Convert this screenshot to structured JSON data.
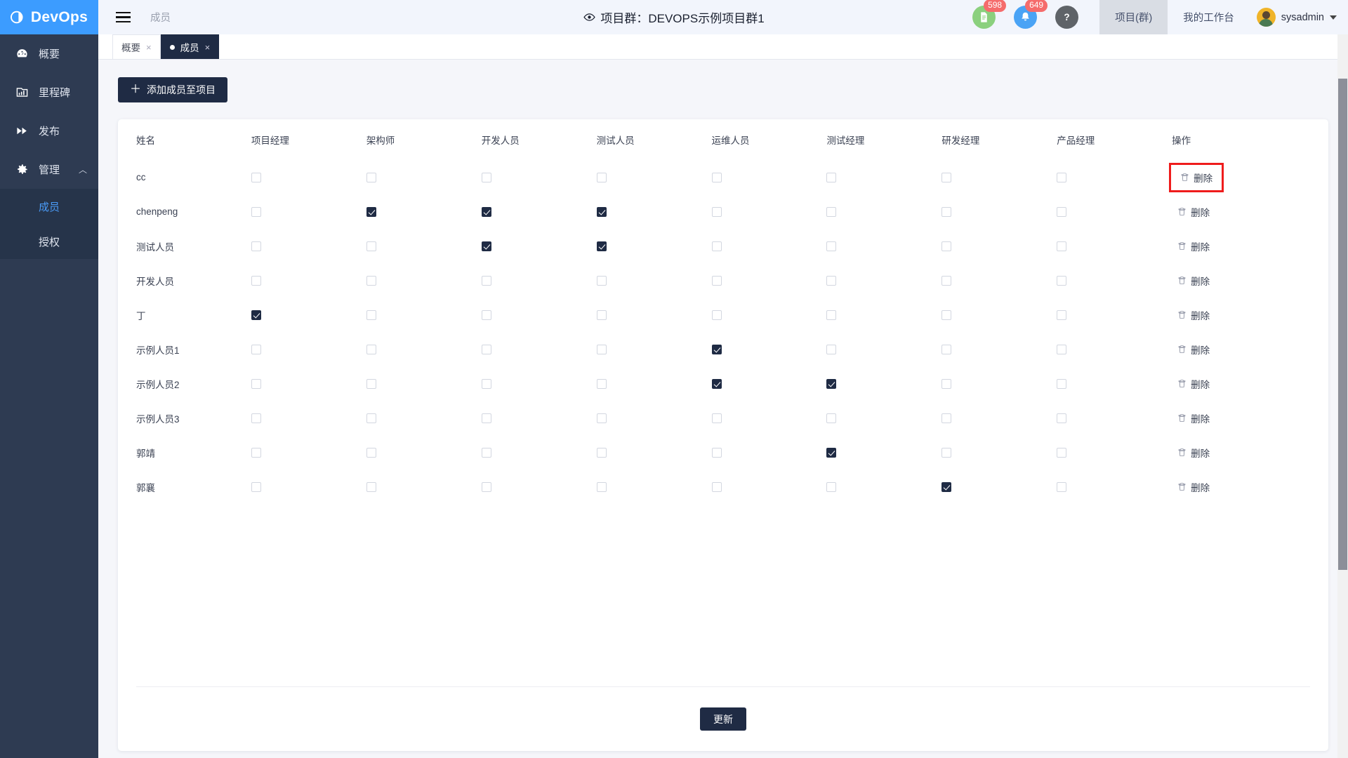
{
  "brand": {
    "name": "DevOps",
    "logo_icon": "devops-logo-icon"
  },
  "topbar": {
    "hamburger_icon": "hamburger-menu-icon",
    "breadcrumb": "成员",
    "eye_icon": "eye-icon",
    "title": "项目群：DEVOPS示例项目群1",
    "doc_icon": "document-icon",
    "doc_badge": "598",
    "bell_icon": "bell-icon",
    "bell_badge": "649",
    "help_icon": "question-mark-icon",
    "nav": [
      {
        "label": "项目(群)",
        "active": true
      },
      {
        "label": "我的工作台",
        "active": false
      }
    ],
    "user": {
      "name": "sysadmin",
      "avatar_icon": "user-avatar-icon",
      "caret_icon": "chevron-down-icon"
    }
  },
  "sidebar": {
    "items": [
      {
        "label": "概要",
        "icon": "dashboard-icon"
      },
      {
        "label": "里程碑",
        "icon": "milestone-chart-icon"
      },
      {
        "label": "发布",
        "icon": "fast-forward-icon"
      },
      {
        "label": "管理",
        "icon": "gear-icon",
        "expanded": true,
        "chevron": "︿"
      }
    ],
    "subitems": [
      {
        "label": "成员",
        "selected": true
      },
      {
        "label": "授权",
        "selected": false
      }
    ]
  },
  "tabs": [
    {
      "label": "概要",
      "active": false,
      "close": "×"
    },
    {
      "label": "成员",
      "active": true,
      "close": "×"
    }
  ],
  "toolbar": {
    "add_member_label": "添加成员至项目",
    "add_plus": "＋"
  },
  "table": {
    "headers": [
      "姓名",
      "项目经理",
      "架构师",
      "开发人员",
      "测试人员",
      "运维人员",
      "测试经理",
      "研发经理",
      "产品经理",
      "操作"
    ],
    "delete_label": "删除",
    "delete_icon": "trash-icon",
    "rows": [
      {
        "name": "cc",
        "roles": [
          false,
          false,
          false,
          false,
          false,
          false,
          false,
          false
        ],
        "highlight": true
      },
      {
        "name": "chenpeng",
        "roles": [
          false,
          true,
          true,
          true,
          false,
          false,
          false,
          false
        ],
        "highlight": false
      },
      {
        "name": "测试人员",
        "roles": [
          false,
          false,
          true,
          true,
          false,
          false,
          false,
          false
        ],
        "highlight": false
      },
      {
        "name": "开发人员",
        "roles": [
          false,
          false,
          false,
          false,
          false,
          false,
          false,
          false
        ],
        "highlight": false
      },
      {
        "name": "丁",
        "roles": [
          true,
          false,
          false,
          false,
          false,
          false,
          false,
          false
        ],
        "highlight": false
      },
      {
        "name": "示例人员1",
        "roles": [
          false,
          false,
          false,
          false,
          true,
          false,
          false,
          false
        ],
        "highlight": false
      },
      {
        "name": "示例人员2",
        "roles": [
          false,
          false,
          false,
          false,
          true,
          true,
          false,
          false
        ],
        "highlight": false
      },
      {
        "name": "示例人员3",
        "roles": [
          false,
          false,
          false,
          false,
          false,
          false,
          false,
          false
        ],
        "highlight": false
      },
      {
        "name": "郭靖",
        "roles": [
          false,
          false,
          false,
          false,
          false,
          true,
          false,
          false
        ],
        "highlight": false
      },
      {
        "name": "郭襄",
        "roles": [
          false,
          false,
          false,
          false,
          false,
          false,
          true,
          false
        ],
        "highlight": false
      }
    ]
  },
  "footer": {
    "update_label": "更新"
  },
  "colors": {
    "brand_blue": "#3c9cff",
    "sidebar_dark": "#2e3b52",
    "sidebar_sub": "#26344a",
    "accent_dark": "#1f2b44",
    "selected_link": "#4a9bf7",
    "badge_red": "#f56c6c",
    "highlight_red": "#ef1c1c",
    "doc_green": "#8bd07e",
    "bell_blue": "#4aa3f5"
  }
}
